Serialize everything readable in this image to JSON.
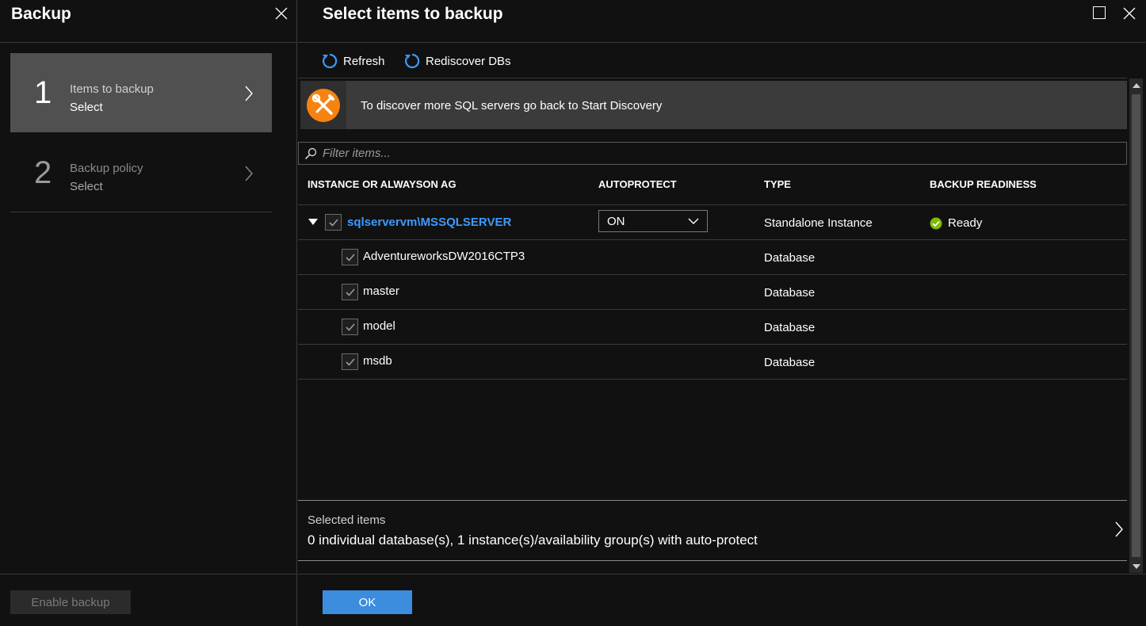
{
  "left_blade": {
    "title": "Backup",
    "steps": [
      {
        "number": "1",
        "label": "Items to backup",
        "sub": "Select",
        "state": "active"
      },
      {
        "number": "2",
        "label": "Backup policy",
        "sub": "Select",
        "state": "inactive"
      }
    ],
    "enable_button": "Enable backup"
  },
  "right_blade": {
    "title": "Select items to backup",
    "toolbar": {
      "refresh_label": "Refresh",
      "rediscover_label": "Rediscover DBs"
    },
    "banner": {
      "icon": "wrench-screwdriver-icon",
      "text": "To discover more SQL servers go back to Start Discovery"
    },
    "filter": {
      "placeholder": "Filter items...",
      "value": ""
    },
    "table": {
      "headers": [
        "INSTANCE OR ALWAYSON AG",
        "AUTOPROTECT",
        "TYPE",
        "BACKUP READINESS"
      ],
      "instance": {
        "name": "sqlservervm\\MSSQLSERVER",
        "checked": true,
        "autoprotect": "ON",
        "type": "Standalone Instance",
        "readiness": "Ready"
      },
      "databases": [
        {
          "name": "AdventureworksDW2016CTP3",
          "type": "Database",
          "checked": true
        },
        {
          "name": "master",
          "type": "Database",
          "checked": true
        },
        {
          "name": "model",
          "type": "Database",
          "checked": true
        },
        {
          "name": "msdb",
          "type": "Database",
          "checked": true
        }
      ]
    },
    "selected_items": {
      "label": "Selected items",
      "value": "0 individual database(s), 1 instance(s)/availability group(s) with auto-protect"
    },
    "ok_button": "OK"
  },
  "colors": {
    "accent": "#3c8dde",
    "link": "#3c9bff",
    "banner_icon": "#f7830f",
    "ready": "#7fba00"
  }
}
